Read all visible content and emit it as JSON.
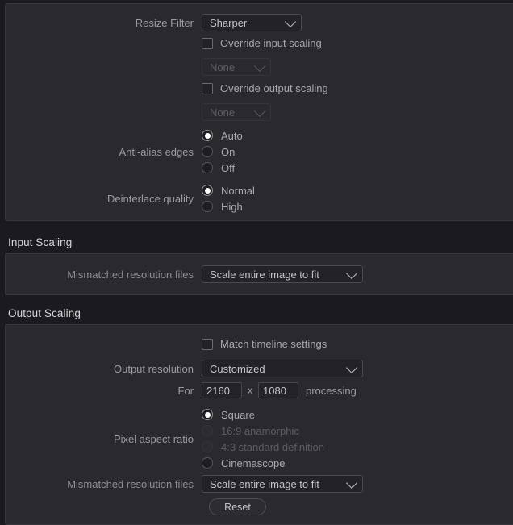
{
  "panels": {
    "resize": {
      "resize_filter": {
        "label": "Resize Filter",
        "value": "Sharper"
      },
      "override_input": {
        "label": "Override input scaling",
        "checked": false,
        "dropdown_value": "None"
      },
      "override_output": {
        "label": "Override output scaling",
        "checked": false,
        "dropdown_value": "None"
      },
      "anti_alias": {
        "label": "Anti-alias edges",
        "options": [
          "Auto",
          "On",
          "Off"
        ],
        "selected": "Auto"
      },
      "deinterlace": {
        "label": "Deinterlace quality",
        "options": [
          "Normal",
          "High"
        ],
        "selected": "Normal"
      }
    },
    "input_scaling": {
      "header": "Input Scaling",
      "mismatched": {
        "label": "Mismatched resolution files",
        "value": "Scale entire image to fit"
      }
    },
    "output_scaling": {
      "header": "Output Scaling",
      "match_timeline": {
        "label": "Match timeline settings",
        "checked": false
      },
      "output_resolution": {
        "label": "Output resolution",
        "value": "Customized"
      },
      "resolution_fields": {
        "prefix": "For",
        "width": "2160",
        "separator": "x",
        "height": "1080",
        "suffix": "processing"
      },
      "pixel_aspect_ratio": {
        "label": "Pixel aspect ratio",
        "options": [
          {
            "text": "Square",
            "selected": true,
            "disabled": false
          },
          {
            "text": "16:9 anamorphic",
            "selected": false,
            "disabled": true
          },
          {
            "text": "4:3 standard definition",
            "selected": false,
            "disabled": true
          },
          {
            "text": "Cinemascope",
            "selected": false,
            "disabled": false
          }
        ]
      },
      "mismatched": {
        "label": "Mismatched resolution files",
        "value": "Scale entire image to fit"
      },
      "reset_label": "Reset"
    }
  },
  "icons": {
    "chevron_down": "chevron-down-icon"
  }
}
